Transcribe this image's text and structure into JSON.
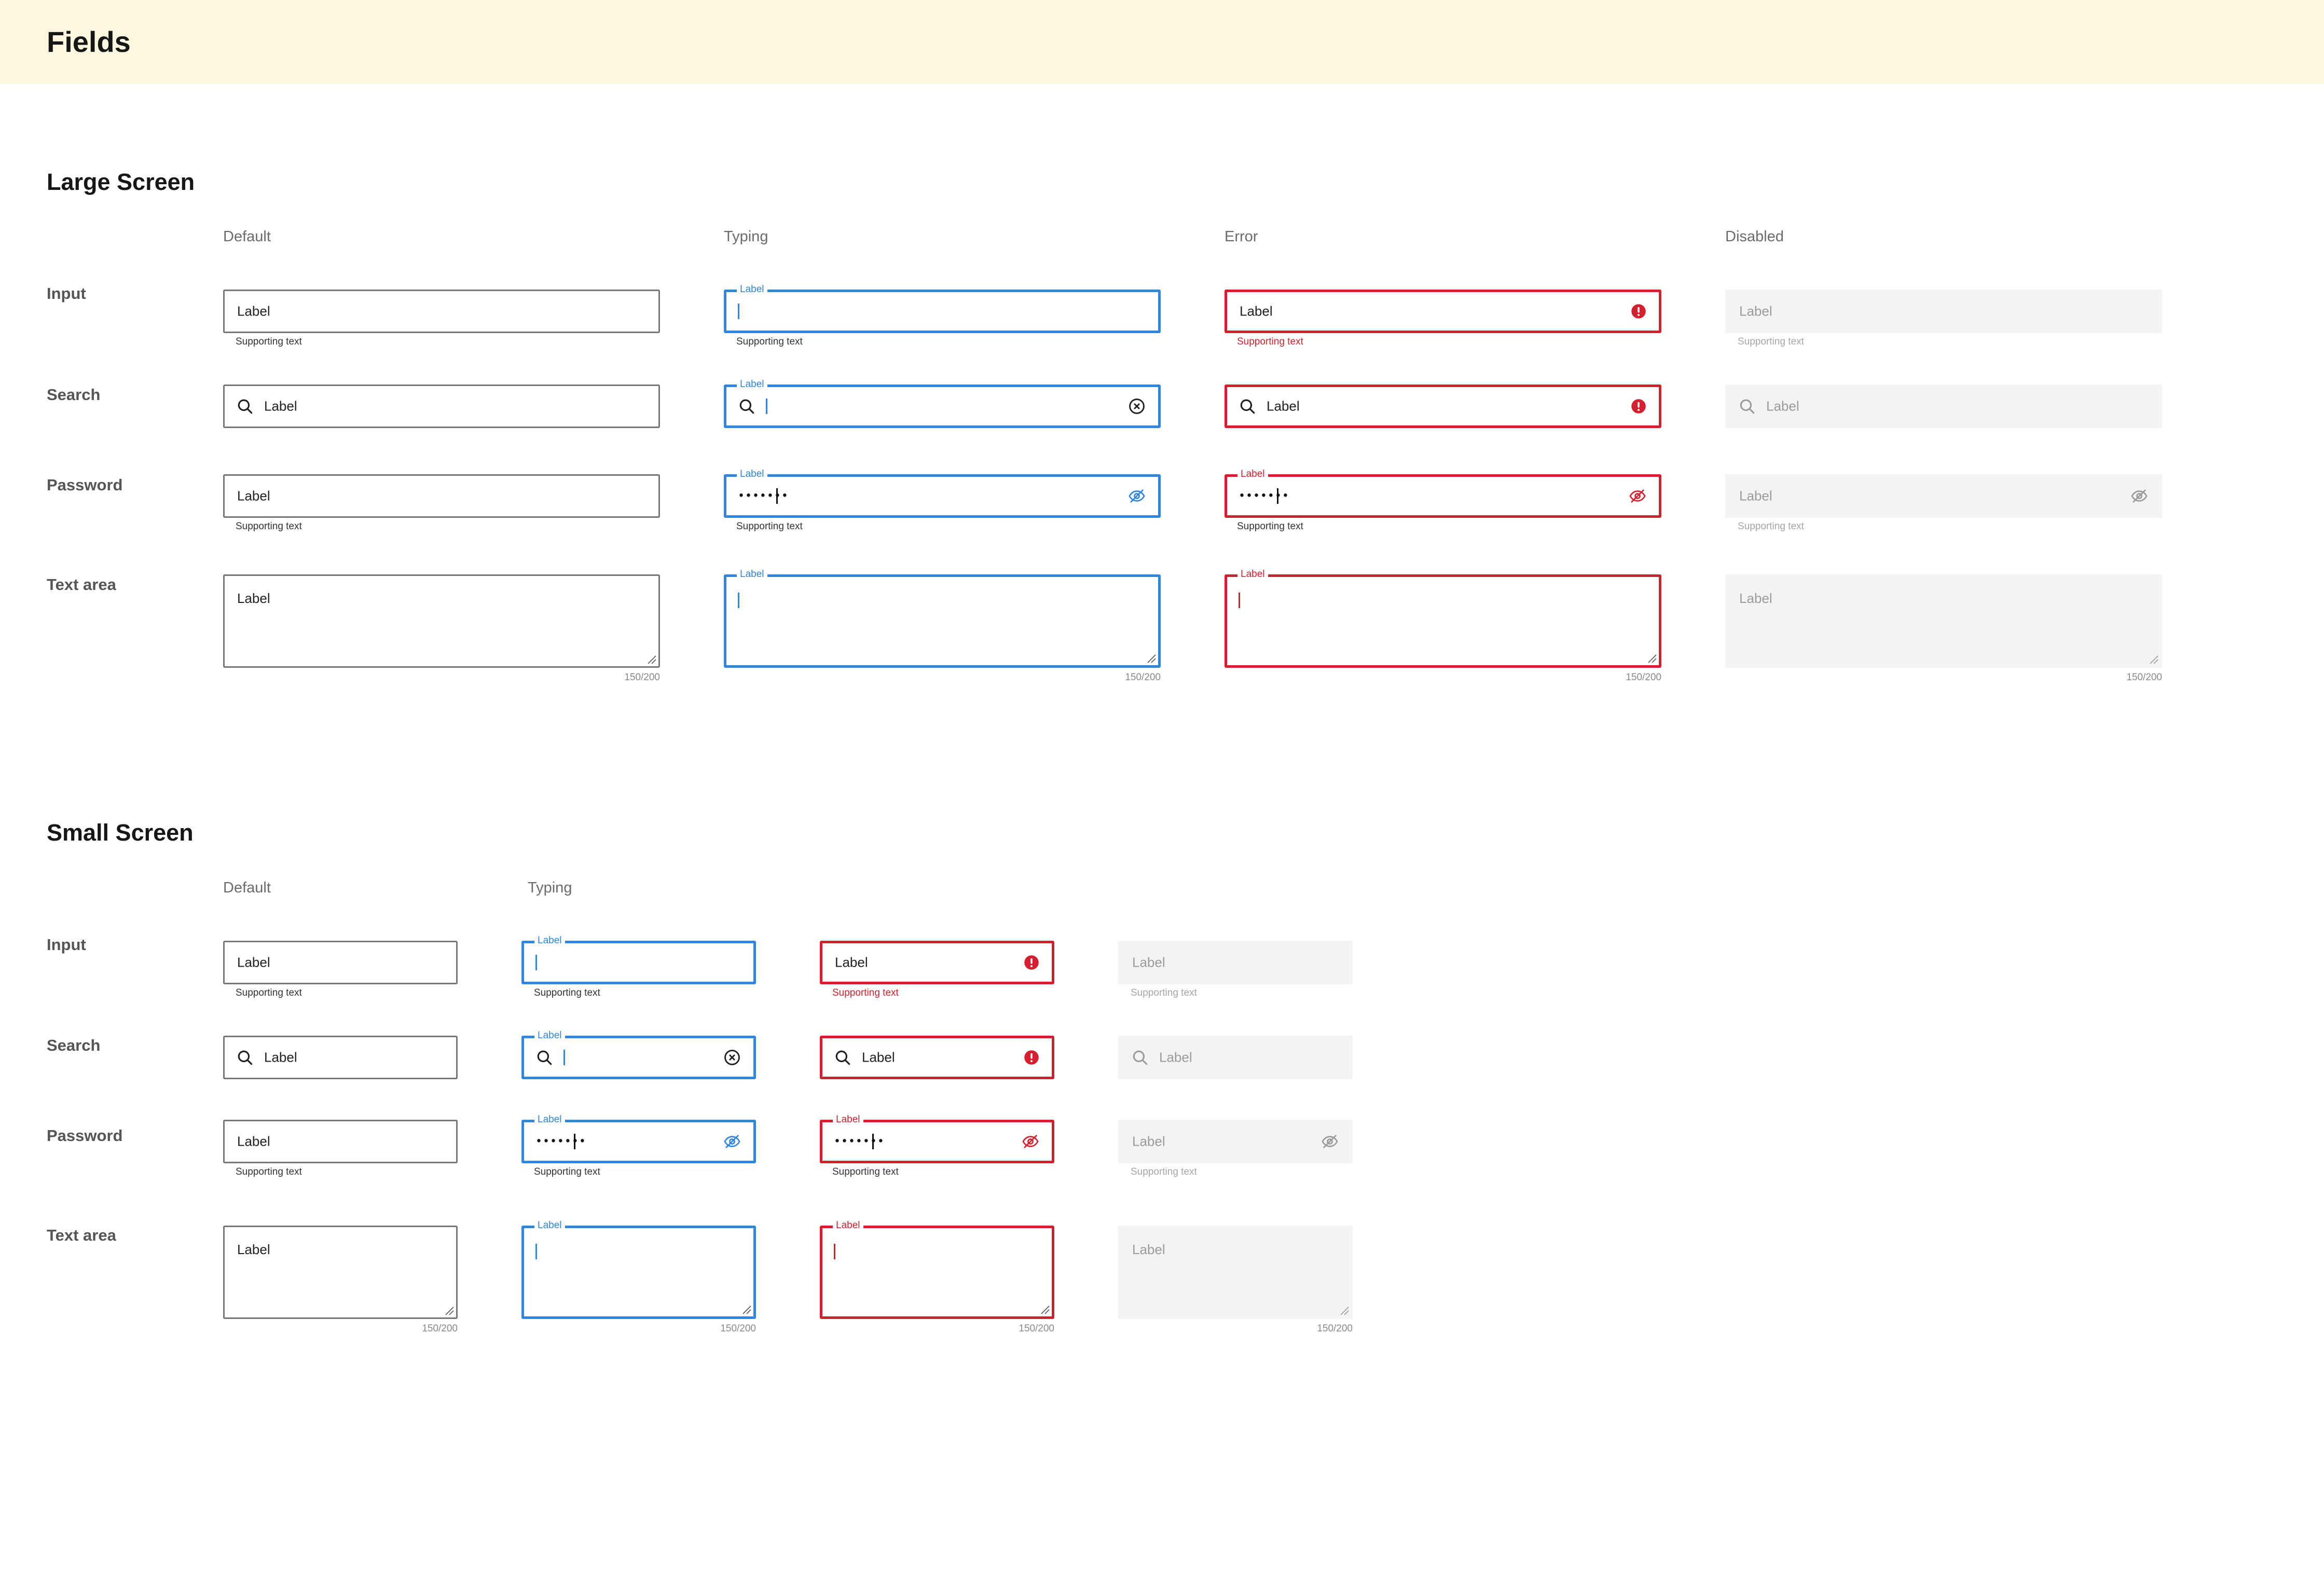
{
  "page_title": "Fields",
  "colors": {
    "header_bg": "#fef7df",
    "default_border": "#767676",
    "typing": "#2e86de",
    "error": "#d51f2e",
    "disabled_bg": "#f3f3f3"
  },
  "large": {
    "title": "Large Screen",
    "columns": [
      "Default",
      "Typing",
      "Error",
      "Disabled"
    ],
    "rows": [
      "Input",
      "Search",
      "Password",
      "Text area"
    ]
  },
  "small": {
    "title": "Small Screen",
    "columns": [
      "Default",
      "Typing"
    ],
    "rows": [
      "Input",
      "Search",
      "Password",
      "Text area"
    ]
  },
  "field": {
    "label": "Label",
    "supporting_text": "Supporting text",
    "password_mask": "•••••••",
    "counter": "150/200"
  },
  "icons": {
    "search": "search-icon",
    "clear": "clear-circle-x-icon",
    "error": "error-circle-icon",
    "visibility": "eye-off-icon",
    "resize": "resize-handle-icon"
  }
}
